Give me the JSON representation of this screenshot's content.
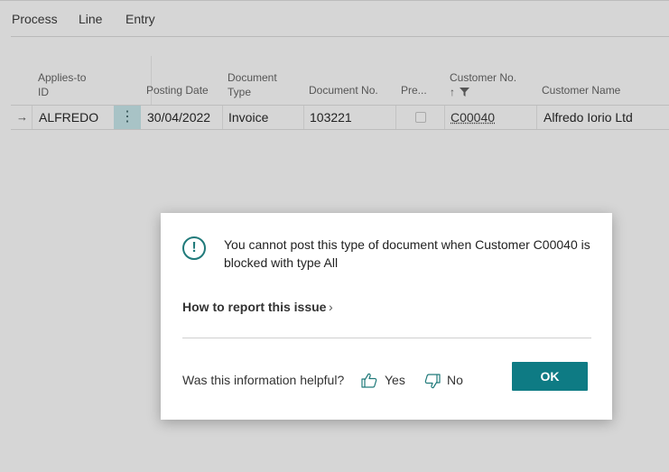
{
  "actions": [
    "Process",
    "Line",
    "Entry"
  ],
  "grid": {
    "headers": {
      "applies_to_id": [
        "Applies-to",
        "ID"
      ],
      "posting_date": "Posting Date",
      "document_type": [
        "Document",
        "Type"
      ],
      "document_no": "Document No.",
      "prepayment": "Pre...",
      "customer_no": "Customer No.",
      "customer_no_sort": "↑",
      "customer_name": "Customer Name"
    },
    "row": {
      "indicator": "→",
      "applies_to_id": "ALFREDO",
      "menu": "⋮",
      "posting_date": "30/04/2022",
      "document_type": "Invoice",
      "document_no": "103221",
      "prepayment_checked": false,
      "customer_no": "C00040",
      "customer_name": "Alfredo Iorio Ltd"
    }
  },
  "dialog": {
    "icon": "!",
    "message": "You cannot post this type of document when Customer C00040 is blocked with type All",
    "report_link": "How to report this issue",
    "report_chevron": "›",
    "helpful_question": "Was this information helpful?",
    "yes_label": "Yes",
    "no_label": "No",
    "ok_label": "OK"
  },
  "colors": {
    "accent": "#0e7b84",
    "icon_teal": "#207a7a",
    "selected_cell": "#a8c3c6",
    "background": "#d6d6d6"
  }
}
